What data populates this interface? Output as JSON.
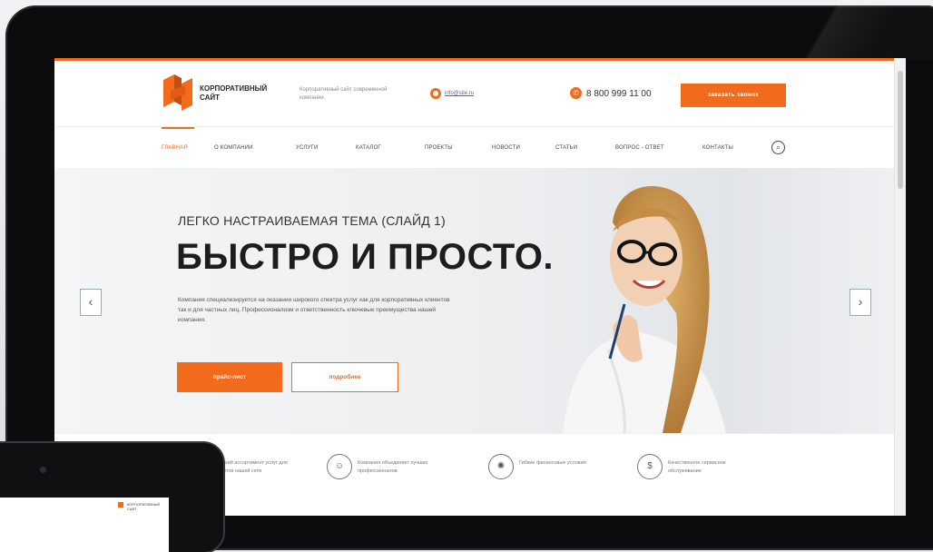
{
  "header": {
    "logo_text": "КОРПОРАТИВНЫЙ САЙТ",
    "tagline": "Корпоративный сайт современной компании",
    "email": "info@site.ru",
    "phone": "8 800 999 11 00",
    "callback_label": "заказать звонок"
  },
  "nav": {
    "items": [
      "ГЛАВНАЯ",
      "О КОМПАНИИ",
      "УСЛУГИ",
      "КАТАЛОГ",
      "ПРОЕКТЫ",
      "НОВОСТИ",
      "СТАТЬИ",
      "ВОПРОС - ОТВЕТ",
      "КОНТАКТЫ"
    ],
    "active_index": 0
  },
  "hero": {
    "subtitle": "ЛЕГКО НАСТРАИВАЕМАЯ ТЕМА (СЛАЙД 1)",
    "title": "БЫСТРО И ПРОСТО.",
    "description": "Компания специализируется на оказании широкого спектра услуг как для корпоративных клиентов так и для частных лиц. Профессионализм и ответственность ключевые преимущества нашей компании.",
    "price_button": "прайс-лист",
    "more_button": "подробнее",
    "prev_arrow": "‹",
    "next_arrow": "›"
  },
  "features": [
    {
      "icon": "award-icon",
      "glyph": "✦",
      "text": "Широкий ассортимент услуг для клиентов нашей сети"
    },
    {
      "icon": "team-icon",
      "glyph": "☺",
      "text": "Компания объединяет лучших профессионалов"
    },
    {
      "icon": "gear-icon",
      "glyph": "✺",
      "text": "Гибкие финансовые условия"
    },
    {
      "icon": "money-icon",
      "glyph": "$",
      "text": "Качественное сервисное обслуживание"
    }
  ],
  "colors": {
    "accent": "#f26b1d"
  }
}
